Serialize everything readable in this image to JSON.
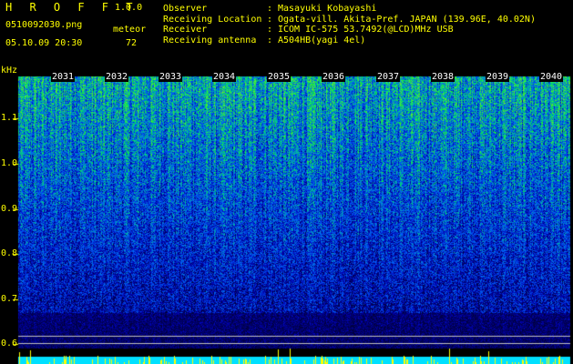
{
  "header": {
    "app_title": "H R O F F T",
    "app_version": "1.0.0",
    "file_name": "0510092030.png",
    "mode_label": "meteor",
    "date_time": "05.10.09 20:30",
    "count": "72"
  },
  "info": [
    {
      "key": "Observer",
      "value": "Masayuki Kobayashi"
    },
    {
      "key": "Receiving Location",
      "value": "Ogata-vill. Akita-Pref. JAPAN (139.96E, 40.02N)"
    },
    {
      "key": "Receiver",
      "value": "ICOM IC-575 53.7492(@LCD)MHz USB"
    },
    {
      "key": "Receiving antenna",
      "value": "A504HB(yagi 4el)"
    }
  ],
  "axis": {
    "unit": "kHz",
    "y_ticks": [
      "1.1",
      "1.0",
      "0.9",
      "0.8",
      "0.7",
      "0.6"
    ],
    "x_labels": [
      "2031",
      "2032",
      "2033",
      "2034",
      "2035",
      "2036",
      "2037",
      "2038",
      "2039",
      "2040"
    ]
  },
  "colors": {
    "text": "#ffff00",
    "hour_label": "#ffffff",
    "background": "#000000",
    "spectrum_low": "#0000a0",
    "spectrum_high": "#00ff40",
    "level_bar": "#00e0ff",
    "level_spike": "#ffff00"
  }
}
